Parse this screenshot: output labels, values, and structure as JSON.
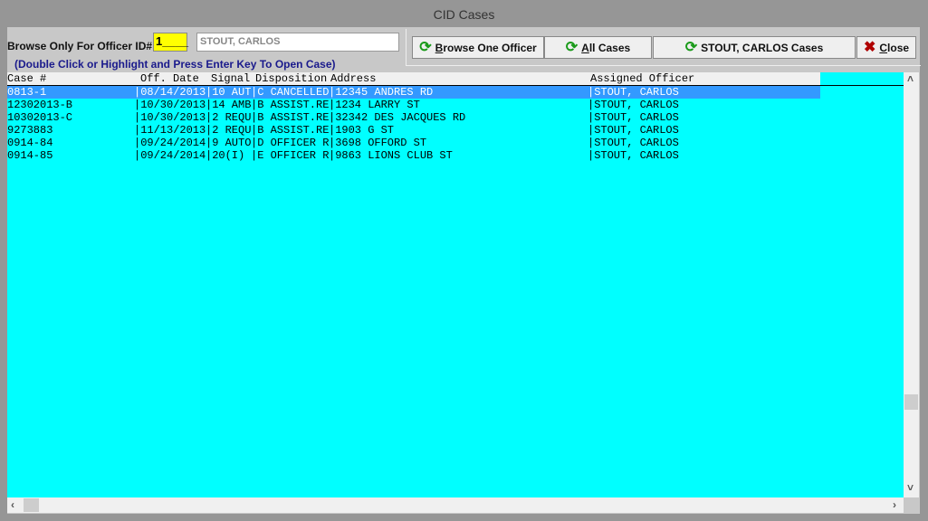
{
  "window": {
    "title": "CID Cases"
  },
  "filter": {
    "label": "Browse Only For Officer ID#",
    "officer_id": "1____",
    "officer_name": "STOUT, CARLOS",
    "hint": "(Double Click or Highlight and Press Enter Key To Open Case)"
  },
  "toolbar": {
    "browse_one": {
      "label_u": "B",
      "label": "rowse One Officer",
      "icon": "refresh-icon"
    },
    "all_cases": {
      "label_u": "A",
      "label": "ll Cases",
      "icon": "refresh-icon"
    },
    "officer_cases": {
      "label": "STOUT, CARLOS Cases",
      "icon": "refresh-icon"
    },
    "close": {
      "label_u": "C",
      "label": "lose",
      "icon": "close-x-icon"
    }
  },
  "grid": {
    "headers": [
      "Case #",
      "Off. Date",
      "Signal",
      "Disposition",
      "Address",
      "Assigned Officer"
    ],
    "colors": {
      "background": "#00ffff",
      "selected": "#3399ff"
    },
    "rows": [
      [
        "0813-1",
        "|08/14/2013",
        "|10 AUT",
        "|C CANCELLED",
        "|12345 ANDRES RD",
        "|STOUT, CARLOS"
      ],
      [
        "12302013-B",
        "|10/30/2013",
        "|14 AMB",
        "|B ASSIST.RE",
        "|1234 LARRY ST",
        "|STOUT, CARLOS"
      ],
      [
        "10302013-C",
        "|10/30/2013",
        "|2 REQU",
        "|B ASSIST.RE",
        "|32342 DES JACQUES RD",
        "|STOUT, CARLOS"
      ],
      [
        "9273883",
        "|11/13/2013",
        "|2 REQU",
        "|B ASSIST.RE",
        "|1903 G ST",
        "|STOUT, CARLOS"
      ],
      [
        "0914-84",
        "|09/24/2014",
        "|9 AUTO",
        "|D OFFICER R",
        "|3698 OFFORD ST",
        "|STOUT, CARLOS"
      ],
      [
        "0914-85",
        "|09/24/2014",
        "|20(I) ",
        "|E OFFICER R",
        "|9863 LIONS CLUB ST",
        "|STOUT, CARLOS"
      ]
    ],
    "selected_row": 0
  }
}
